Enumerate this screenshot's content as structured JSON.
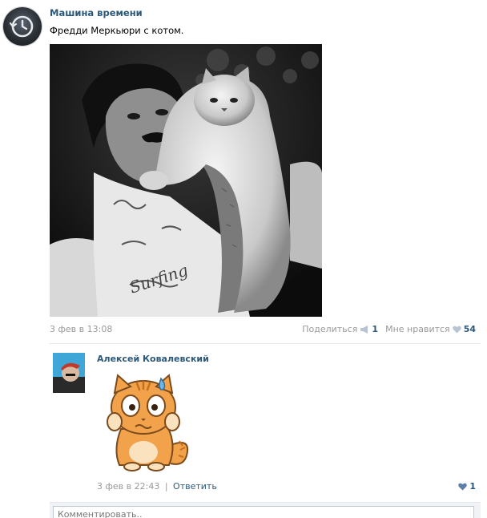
{
  "post": {
    "author": "Машина времени",
    "text": "Фредди Меркьюри с котом.",
    "date": "3 фев в 13:08",
    "share_label": "Поделиться",
    "share_count": "1",
    "like_label": "Мне нравится",
    "like_count": "54",
    "avatar_icon": "clock-history-icon",
    "link_color": "#2b587a"
  },
  "comment": {
    "author": "Алексей Ковалевский",
    "date": "3 фев в 22:43",
    "separator": "|",
    "reply_label": "Ответить",
    "like_count": "1"
  },
  "comment_box": {
    "placeholder": "Комментировать.."
  }
}
